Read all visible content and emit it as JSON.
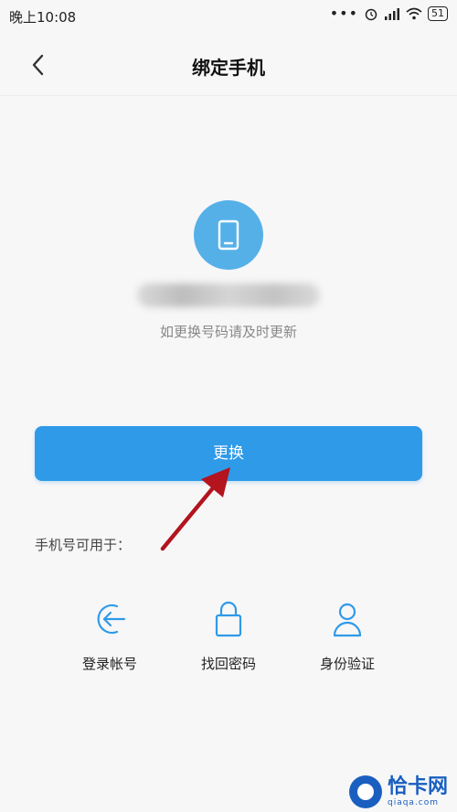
{
  "status_bar": {
    "time": "晚上10:08",
    "dots": "•••",
    "battery": "51"
  },
  "header": {
    "title": "绑定手机"
  },
  "main": {
    "hint": "如更换号码请及时更新",
    "change_button": "更换",
    "usage_label": "手机号可用于：",
    "options": [
      {
        "label": "登录帐号",
        "icon": "login-arrow-icon"
      },
      {
        "label": "找回密码",
        "icon": "lock-icon"
      },
      {
        "label": "身份验证",
        "icon": "user-icon"
      }
    ]
  },
  "watermark": {
    "text": "恰卡网",
    "sub": "qiaqa.com"
  },
  "colors": {
    "accent": "#2f9ae8",
    "icon_circle": "#56b0e8",
    "arrow": "#b3141e",
    "watermark": "#1a5fbf"
  }
}
